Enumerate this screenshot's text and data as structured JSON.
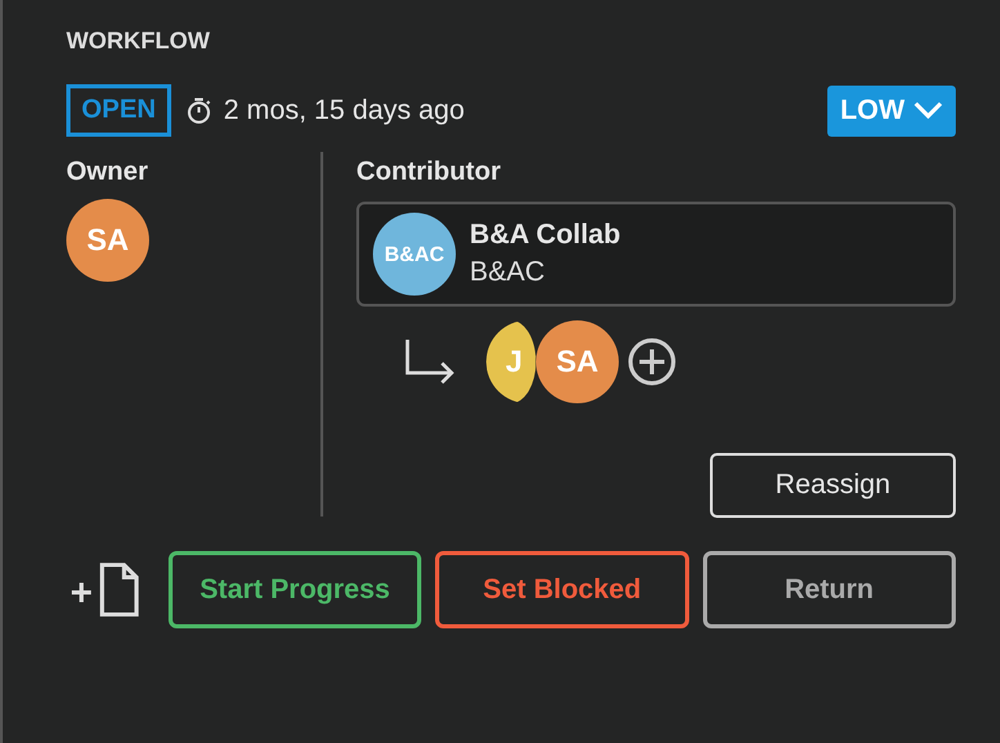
{
  "section_title": "WORKFLOW",
  "status": {
    "label": "OPEN",
    "age": "2 mos, 15 days ago"
  },
  "priority": {
    "label": "LOW"
  },
  "owner": {
    "heading": "Owner",
    "avatar": {
      "initials": "SA",
      "color": "#e48c4a"
    }
  },
  "contributor": {
    "heading": "Contributor",
    "card": {
      "initials": "B&AC",
      "color": "#6fb6dc",
      "name": "B&A Collab",
      "code": "B&AC"
    },
    "members": [
      {
        "initials": "J",
        "color": "#e5c24d"
      },
      {
        "initials": "SA",
        "color": "#e48c4a"
      }
    ],
    "reassign": "Reassign"
  },
  "actions": [
    {
      "label": "Start Progress",
      "kind": "start"
    },
    {
      "label": "Set Blocked",
      "kind": "blocked"
    },
    {
      "label": "Return",
      "kind": "return"
    }
  ]
}
